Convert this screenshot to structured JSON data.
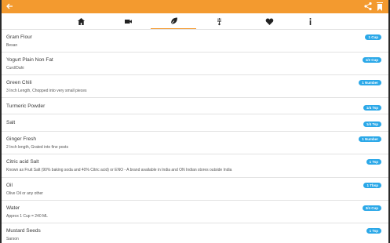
{
  "colors": {
    "accent": "#f39a2f",
    "badge": "#2ba8e8"
  },
  "appbar": {
    "back_icon": "arrow-left-icon",
    "share_icon": "share-icon",
    "bookmark_icon": "bookmark-icon"
  },
  "tabs": [
    {
      "icon": "home-icon"
    },
    {
      "icon": "video-camera-icon"
    },
    {
      "icon": "leaf-icon",
      "active": true
    },
    {
      "icon": "chef-icon"
    },
    {
      "icon": "heart-icon"
    },
    {
      "icon": "info-icon"
    }
  ],
  "ingredients": [
    {
      "name": "Gram Flour",
      "desc": "Besan",
      "qty": "1 Cup"
    },
    {
      "name": "Yogurt Plain Non Fat",
      "desc": "Curd/Dahi",
      "qty": "1/2 Cup"
    },
    {
      "name": "Green Chili",
      "desc": "3 Inch Length, Chopped into very small pieces",
      "qty": "1 Number"
    },
    {
      "name": "Turmeric Powder",
      "desc": "",
      "qty": "1/4 Tsp"
    },
    {
      "name": "Salt",
      "desc": "",
      "qty": "1/4 Tsp"
    },
    {
      "name": "Ginger Fresh",
      "desc": "2 Inch length, Grated into fine posts",
      "qty": "1 Number"
    },
    {
      "name": "Citric acid Salt",
      "desc": "Known as Fruit Salt (90% baking soda and 40% Citric acid) or ENO - A brand available in India and ON Indian stores outside India",
      "qty": "1 Tsp"
    },
    {
      "name": "Oil",
      "desc": "Olive Oil or any other",
      "qty": "1 Tbsp"
    },
    {
      "name": "Water",
      "desc": "Approx 1 Cup = 240 ML",
      "qty": "3/4 Cup"
    },
    {
      "name": "Mustard Seeds",
      "desc": "Sarson",
      "qty": "1 Tsp"
    }
  ]
}
